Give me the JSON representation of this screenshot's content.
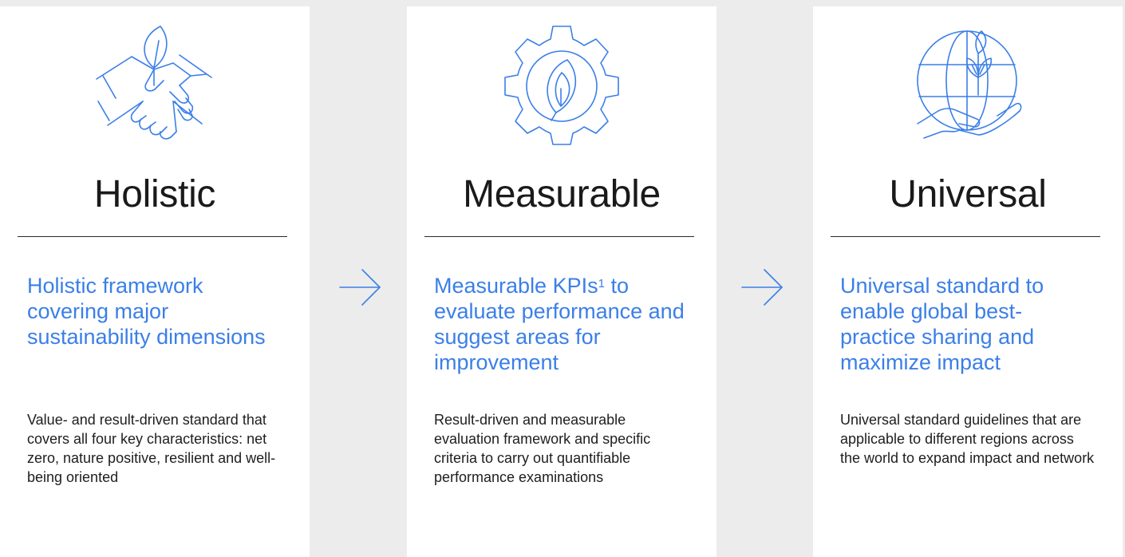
{
  "colors": {
    "accent": "#3b7fe8",
    "card_bg": "#ffffff",
    "page_bg": "#ececec",
    "text": "#1e1e1e"
  },
  "cards": [
    {
      "icon": "handshake-leaf-icon",
      "title": "Holistic",
      "subtitle": "Holistic framework covering major sustainability dimensions",
      "body": "Value- and result-driven standard that covers all four key characteristics: net zero, nature positive, resilient and well-being oriented"
    },
    {
      "icon": "gear-leaf-icon",
      "title": "Measurable",
      "subtitle_pre": "Measurable KPIs",
      "subtitle_sup": "1",
      "subtitle_post": " to evaluate performance and suggest areas for improvement",
      "body": "Result-driven and measurable evaluation framework and specific criteria to carry out quantifiable performance examinations"
    },
    {
      "icon": "globe-hand-sprout-icon",
      "title": "Universal",
      "subtitle": "Universal standard to enable global best-practice sharing and maximize impact",
      "body": "Universal standard guidelines that are applicable to different regions across the world to expand impact and network"
    }
  ],
  "arrows": [
    "arrow-right-icon",
    "arrow-right-icon"
  ]
}
